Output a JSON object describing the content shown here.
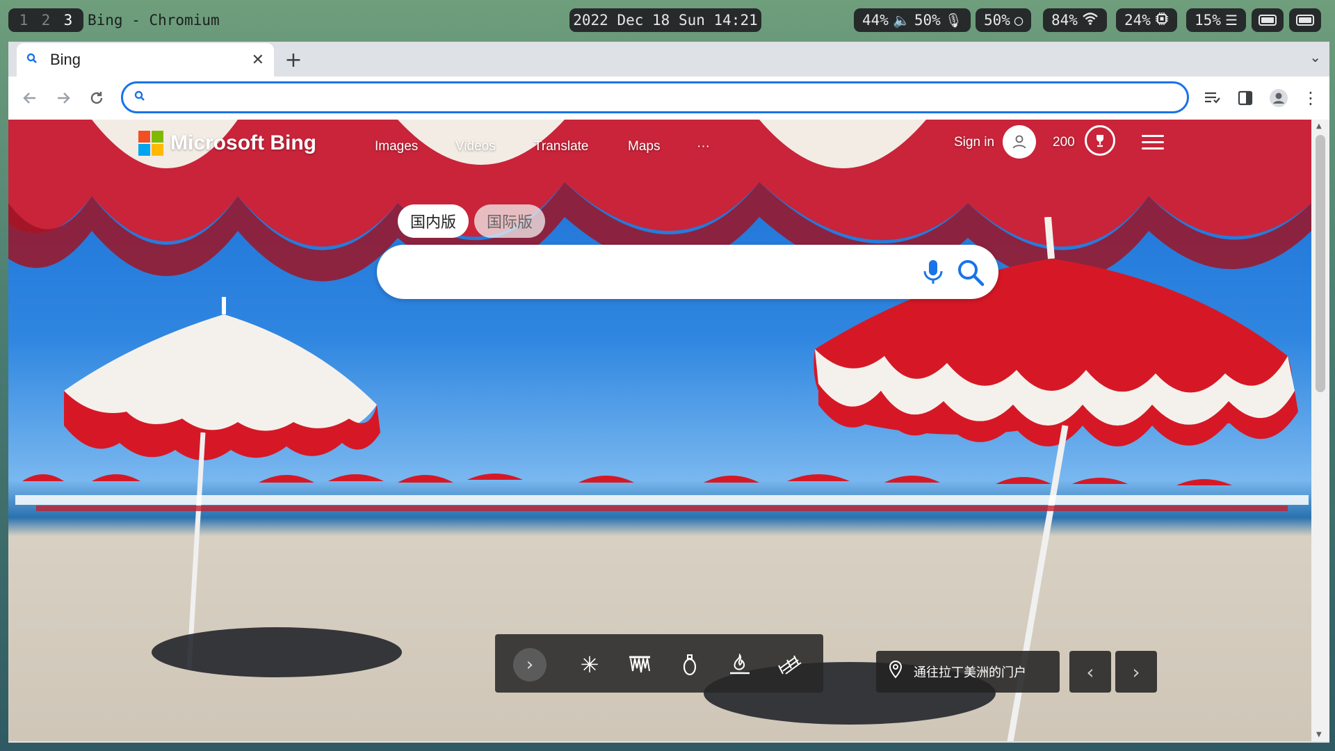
{
  "desktop": {
    "workspaces": [
      "1",
      "2",
      "3"
    ],
    "active_workspace": "3",
    "window_title": "Bing - Chromium",
    "clock": "2022 Dec 18 Sun 14:21",
    "status": {
      "volume": "44%",
      "mic": "50%",
      "brightness": "50%",
      "wifi": "84%",
      "cpu": "24%",
      "memory": "15%"
    }
  },
  "browser": {
    "tab_title": "Bing",
    "address_value": ""
  },
  "bing": {
    "logo_text": "Microsoft Bing",
    "nav": [
      "Images",
      "Videos",
      "Translate",
      "Maps",
      "···"
    ],
    "sign_in": "Sign in",
    "points": "200",
    "versions": [
      "国内版",
      "国际版"
    ],
    "active_version": "国内版",
    "search_value": "",
    "location_caption": "通往拉丁美洲的门户"
  },
  "colors": {
    "accent": "#1a73e8",
    "logo_red": "#f25022",
    "logo_green": "#7fba00",
    "logo_blue": "#00a4ef",
    "logo_yellow": "#ffb900",
    "umbrella_red": "#d61826"
  }
}
